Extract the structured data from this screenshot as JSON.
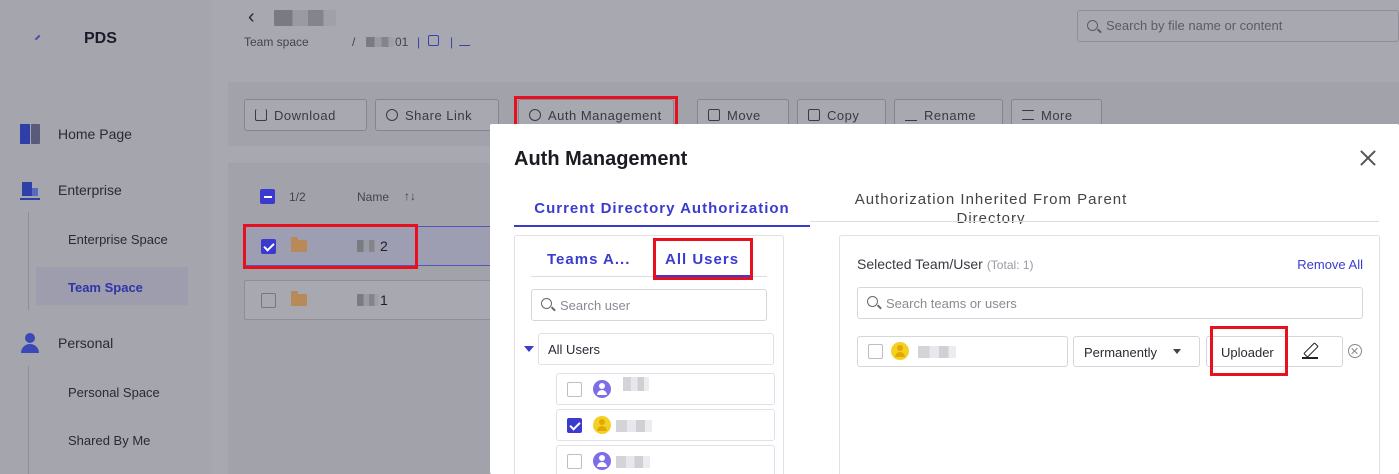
{
  "brand": {
    "name": "PDS"
  },
  "sidebar": {
    "items": [
      {
        "label": "Home Page",
        "icon": "home-icon"
      },
      {
        "label": "Enterprise",
        "icon": "enterprise-icon"
      },
      {
        "label": "Enterprise Space"
      },
      {
        "label": "Team Space",
        "active": true
      },
      {
        "label": "Personal",
        "icon": "person-icon"
      },
      {
        "label": "Personal Space"
      },
      {
        "label": "Shared By Me"
      }
    ]
  },
  "header": {
    "breadcrumb_root": "Team space",
    "breadcrumb_sep": "/",
    "breadcrumb_suffix": "01",
    "search_placeholder": "Search by file name or content"
  },
  "toolbar": {
    "download": "Download",
    "share_link": "Share Link",
    "auth_management": "Auth Management",
    "move": "Move",
    "copy": "Copy",
    "rename": "Rename",
    "more": "More"
  },
  "file_list": {
    "selection_count": "1/2",
    "name_header": "Name",
    "sort_icon": "sort-icon",
    "rows": [
      {
        "suffix": "2",
        "selected": true
      },
      {
        "suffix": "1",
        "selected": false
      }
    ]
  },
  "modal": {
    "title": "Auth Management",
    "tab_current": "Current Directory Authorization",
    "tab_inherited": "Authorization Inherited From Parent Directory",
    "left": {
      "tab_teams": "Teams A...",
      "tab_all_users": "All Users",
      "search_placeholder": "Search user",
      "tree_root": "All Users",
      "users": [
        {
          "checked": false,
          "avatar_color": "#7b6ee8"
        },
        {
          "checked": true,
          "avatar_color": "#f5d024"
        },
        {
          "checked": false,
          "avatar_color": "#7b6ee8"
        }
      ]
    },
    "right": {
      "title": "Selected Team/User",
      "total": "(Total: 1)",
      "remove_all": "Remove All",
      "search_placeholder": "Search teams or users",
      "expiry": "Permanently",
      "role": "Uploader"
    }
  },
  "colors": {
    "accent": "#3b3bcf",
    "highlight_box": "#e8101e",
    "overlay": "#a8a8b0"
  }
}
